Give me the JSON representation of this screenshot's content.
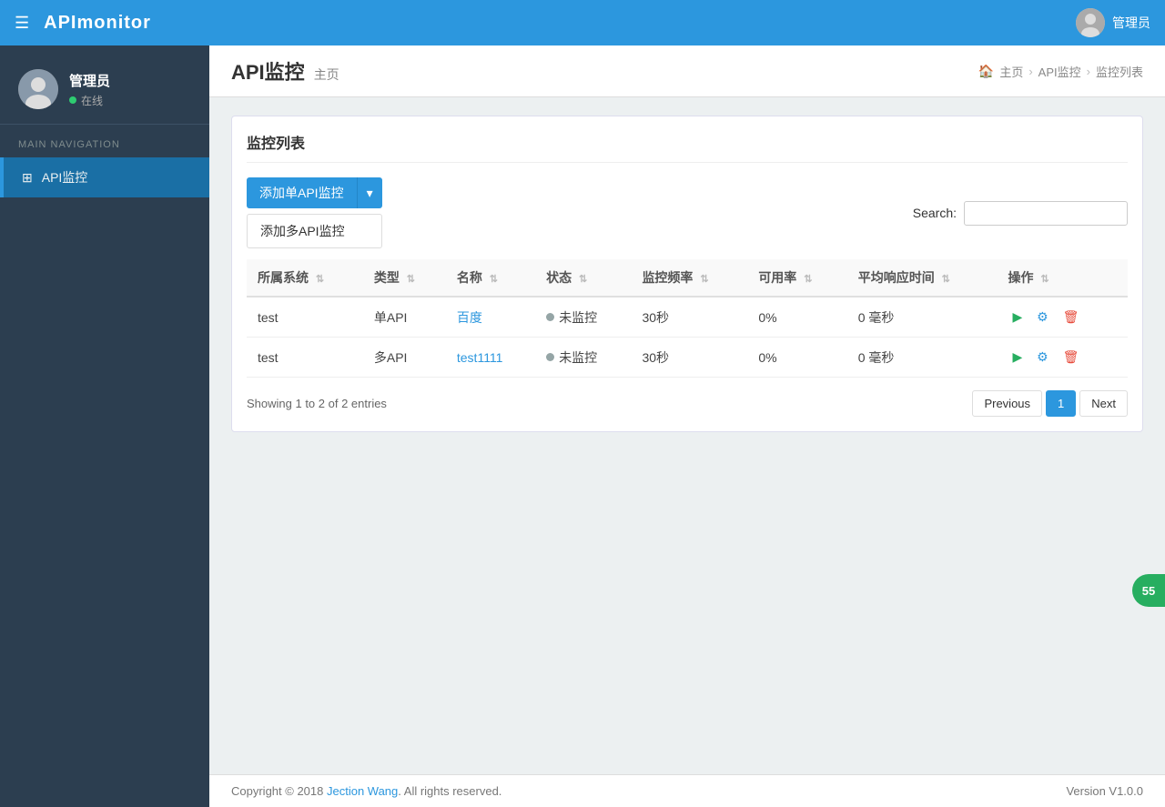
{
  "app": {
    "title": "APImonitor"
  },
  "topbar": {
    "admin_label": "管理员"
  },
  "sidebar": {
    "user_name": "管理员",
    "user_status": "在线",
    "nav_section": "MAIN NAVIGATION",
    "nav_items": [
      {
        "id": "api-monitor",
        "label": "API监控",
        "icon": "⊞"
      }
    ]
  },
  "page": {
    "title": "API监控",
    "subtitle": "主页",
    "breadcrumb": [
      {
        "label": "主页"
      },
      {
        "label": "API监控"
      },
      {
        "label": "监控列表"
      }
    ]
  },
  "panel": {
    "title": "监控列表",
    "add_single_label": "添加单API监控",
    "add_multi_label": "添加多API监控",
    "search_label": "Search:",
    "search_placeholder": ""
  },
  "table": {
    "columns": [
      {
        "key": "system",
        "label": "所属系统"
      },
      {
        "key": "type",
        "label": "类型"
      },
      {
        "key": "name",
        "label": "名称"
      },
      {
        "key": "status",
        "label": "状态"
      },
      {
        "key": "frequency",
        "label": "监控频率"
      },
      {
        "key": "availability",
        "label": "可用率"
      },
      {
        "key": "avg_response",
        "label": "平均响应时间"
      },
      {
        "key": "actions",
        "label": "操作"
      }
    ],
    "rows": [
      {
        "system": "test",
        "type": "单API",
        "name": "百度",
        "name_link": true,
        "status": "未监控",
        "frequency": "30秒",
        "availability": "0%",
        "avg_response": "0 毫秒"
      },
      {
        "system": "test",
        "type": "多API",
        "name": "test1111",
        "name_link": true,
        "status": "未监控",
        "frequency": "30秒",
        "availability": "0%",
        "avg_response": "0 毫秒"
      }
    ]
  },
  "pagination": {
    "info": "Showing 1 to 2 of 2 entries",
    "prev_label": "Previous",
    "next_label": "Next",
    "current_page": 1
  },
  "footer": {
    "copyright": "Copyright © 2018 ",
    "author": "Jection Wang",
    "rights": ". All rights reserved.",
    "version": "Version V1.0.0"
  },
  "float": {
    "badge": "55"
  }
}
